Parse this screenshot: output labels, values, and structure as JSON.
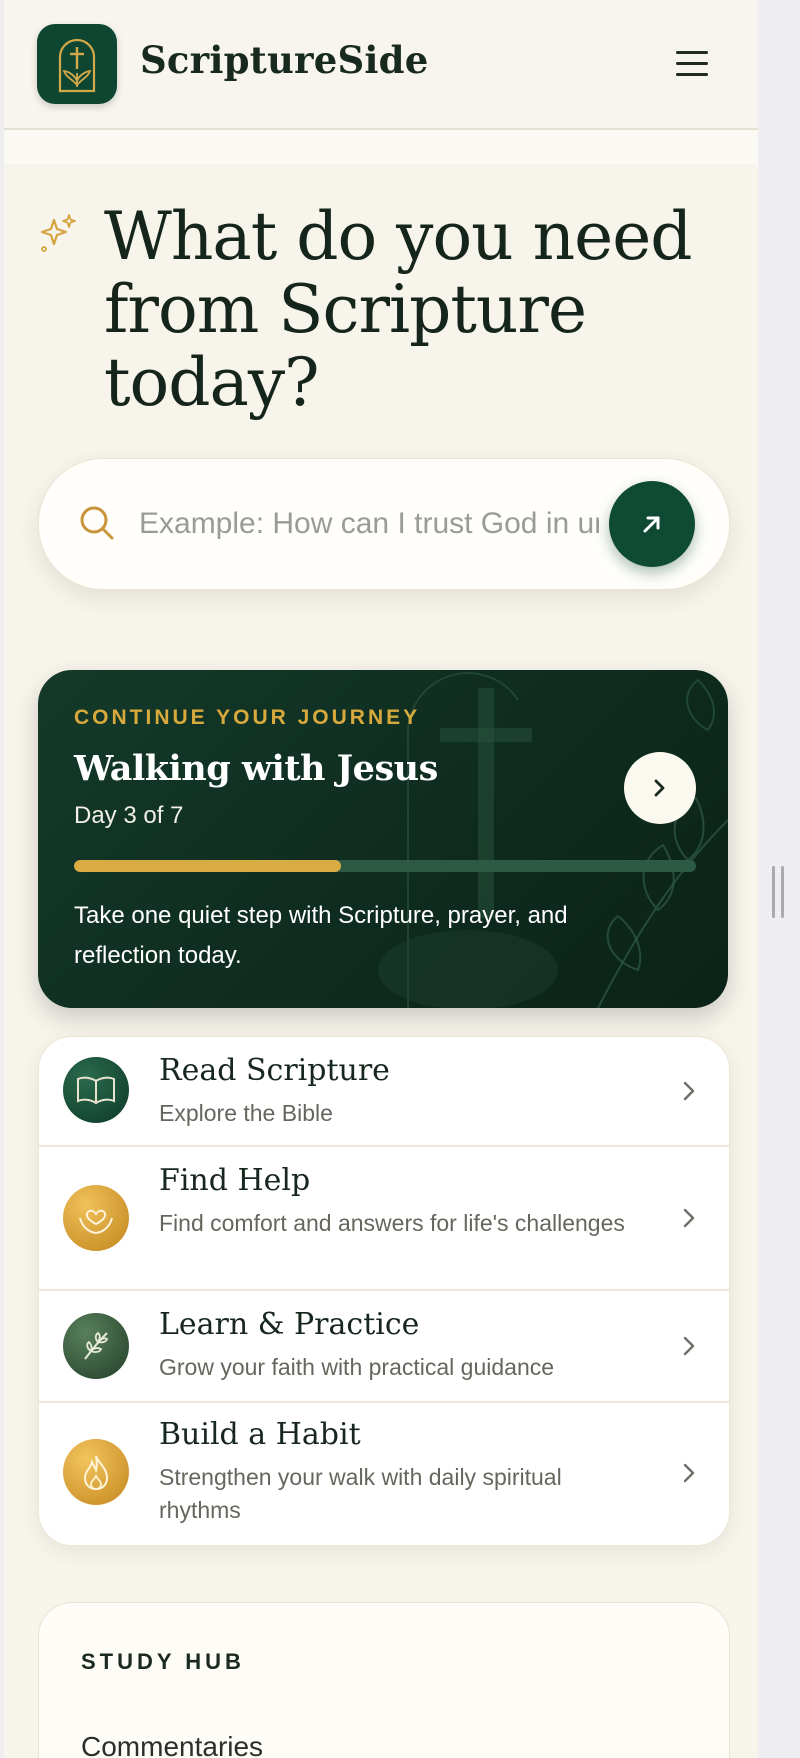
{
  "header": {
    "brand": "ScriptureSide",
    "logo_icon": "cross-dove-logo-icon",
    "menu_icon": "hamburger-menu-icon"
  },
  "hero": {
    "title": "What do you need from Scripture today?",
    "icon": "sparkle-icon"
  },
  "search": {
    "placeholder": "Example: How can I trust God in uncertain times?",
    "icon": "search-icon",
    "submit_icon": "arrow-up-right-icon"
  },
  "journey": {
    "eyebrow": "CONTINUE YOUR JOURNEY",
    "title": "Walking with Jesus",
    "day": "Day 3 of 7",
    "progress": 0.43,
    "description": "Take one quiet step with Scripture, prayer, and reflection today.",
    "next_icon": "chevron-right-icon"
  },
  "menu": {
    "items": [
      {
        "title": "Read Scripture",
        "subtitle": "Explore the Bible",
        "icon": "open-book-icon",
        "color": "#0f4632"
      },
      {
        "title": "Find Help",
        "subtitle": "Find comfort and answers for life's challenges",
        "icon": "hands-heart-icon",
        "color": "#d39a2a"
      },
      {
        "title": "Learn & Practice",
        "subtitle": "Grow your faith with practical guidance",
        "icon": "olive-branch-icon",
        "color": "#345a3a"
      },
      {
        "title": "Build a Habit",
        "subtitle": "Strengthen your walk with daily spiritual rhythms",
        "icon": "flame-icon",
        "color": "#d39a2a"
      }
    ]
  },
  "study_hub": {
    "label": "STUDY HUB",
    "first_link": "Commentaries"
  },
  "colors": {
    "accent_green": "#0e4a34",
    "accent_gold": "#d9ab43",
    "background": "#f7f4ec"
  }
}
